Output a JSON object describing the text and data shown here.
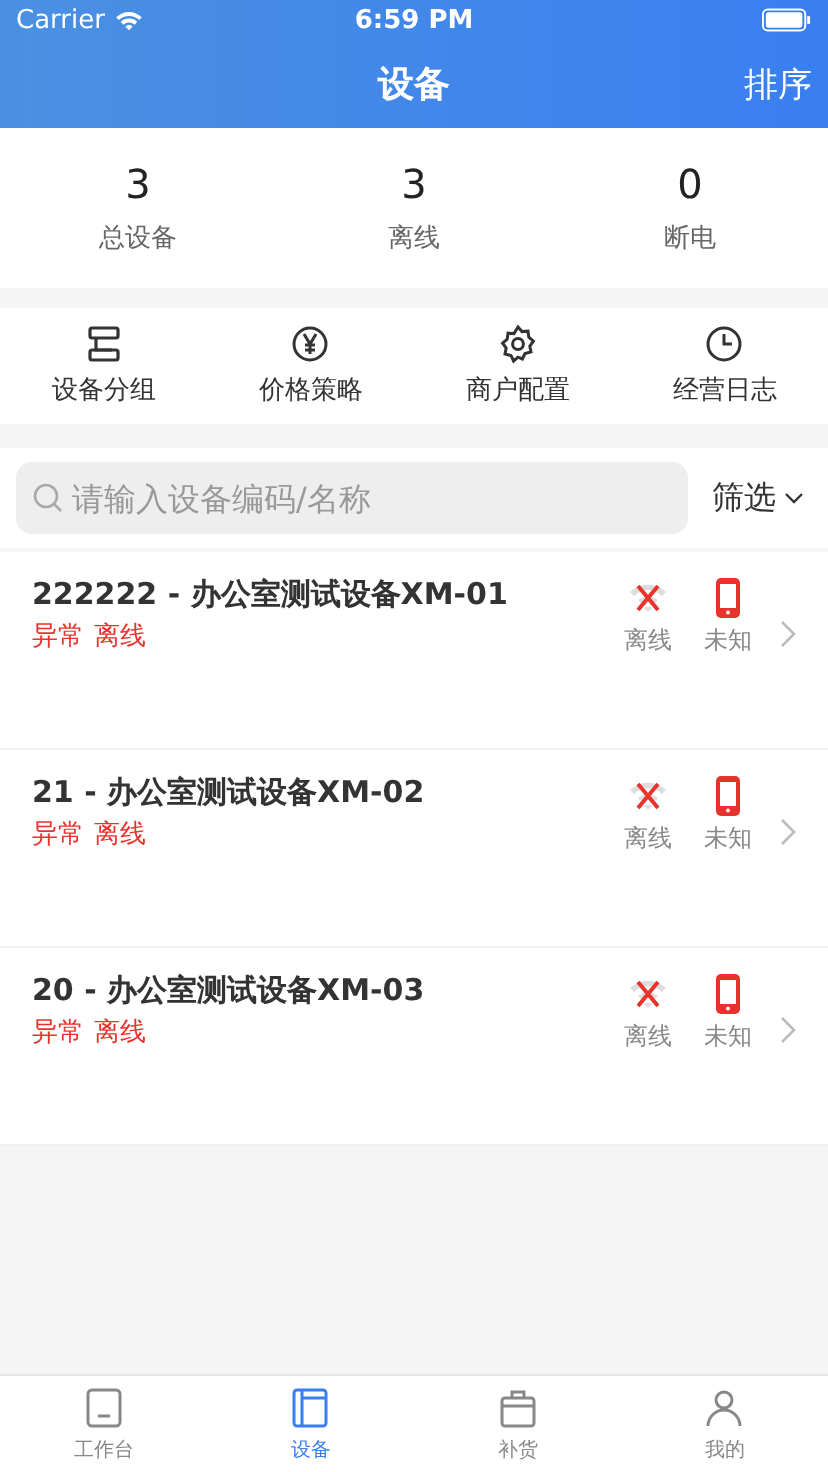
{
  "status_bar": {
    "carrier": "Carrier",
    "time": "6:59 PM"
  },
  "nav": {
    "title": "设备",
    "action": "排序"
  },
  "stats": [
    {
      "value": "3",
      "label": "总设备"
    },
    {
      "value": "3",
      "label": "离线"
    },
    {
      "value": "0",
      "label": "断电"
    }
  ],
  "shortcuts": [
    {
      "label": "设备分组",
      "kind": "group"
    },
    {
      "label": "价格策略",
      "kind": "price"
    },
    {
      "label": "商户配置",
      "kind": "gear"
    },
    {
      "label": "经营日志",
      "kind": "clock"
    }
  ],
  "search": {
    "placeholder": "请输入设备编码/名称"
  },
  "filter": {
    "label": "筛选"
  },
  "devices": [
    {
      "name": "222222 - 办公室测试设备XM-01",
      "tags": [
        "异常",
        "离线"
      ],
      "network": "离线",
      "power": "未知"
    },
    {
      "name": "21 - 办公室测试设备XM-02",
      "tags": [
        "异常",
        "离线"
      ],
      "network": "离线",
      "power": "未知"
    },
    {
      "name": "20 - 办公室测试设备XM-03",
      "tags": [
        "异常",
        "离线"
      ],
      "network": "离线",
      "power": "未知"
    }
  ],
  "tab_bar": [
    {
      "label": "工作台",
      "kind": "desk",
      "selected": false
    },
    {
      "label": "设备",
      "kind": "book",
      "selected": true
    },
    {
      "label": "补货",
      "kind": "box",
      "selected": false
    },
    {
      "label": "我的",
      "kind": "user",
      "selected": false
    }
  ]
}
